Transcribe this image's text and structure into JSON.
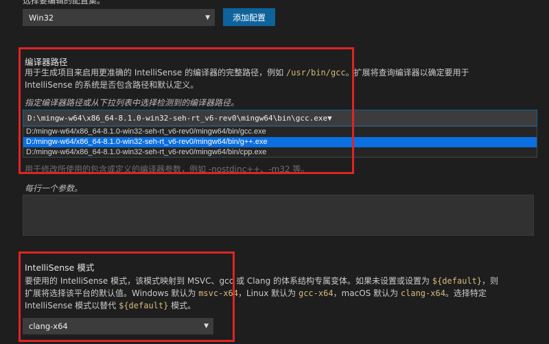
{
  "config": {
    "label": "选择要编辑的配置集。",
    "select_value": "Win32",
    "add_button": "添加配置"
  },
  "compiler_path": {
    "heading": "编译器路径",
    "desc_line1_pre": "用于生成项目来启用更准确的 IntelliSense 的编译器的完整路径，例如 ",
    "desc_line1_code": "/usr/bin/gcc",
    "desc_line1_post": "。扩展将查询编译器以确定要用于",
    "desc_line2": "IntelliSense 的系统是否包含路径和默认定义。",
    "hint": "指定编译器路径或从下拉列表中选择检测到的编译器路径。",
    "input_value": "D:\\mingw-w64\\x86_64-8.1.0-win32-seh-rt_v6-rev0\\mingw64\\bin\\gcc.exe",
    "options": [
      "D:/mingw-w64/x86_64-8.1.0-win32-seh-rt_v6-rev0/mingw64/bin/gcc.exe",
      "D:/mingw-w64/x86_64-8.1.0-win32-seh-rt_v6-rev0/mingw64/bin/g++.exe",
      "D:/mingw-w64/x86_64-8.1.0-win32-seh-rt_v6-rev0/mingw64/bin/cpp.exe"
    ],
    "selected_index": 1
  },
  "compiler_args": {
    "obscured_desc": "用于修改所使用的包含或定义的编译器参数，例如 -nostdinc++、-m32 等。",
    "hint": "每行一个参数。"
  },
  "intellisense_mode": {
    "heading": "IntelliSense 模式",
    "line1_a": "要使用的 IntelliSense 模式，该模式映射到 MSVC、gcc 或 Clang 的体系结构专属变体。如果未设置或设置为 ",
    "line1_code": "${default}",
    "line1_b": "，则",
    "line2_a": "扩展将选择该平台的默认值。Windows 默认为 ",
    "line2_code1": "msvc-x64",
    "line2_b": "，Linux 默认为 ",
    "line2_code2": "gcc-x64",
    "line2_c": "，macOS 默认为 ",
    "line2_code3": "clang-x64",
    "line2_d": "。选择特定",
    "line3_a": "IntelliSense 模式以替代 ",
    "line3_code": "${default}",
    "line3_b": " 模式。",
    "select_value": "clang-x64"
  },
  "colors": {
    "background": "#1e1e1e",
    "accent": "#0e639c",
    "highlight": "#e02424",
    "selection": "#0b6fe0"
  }
}
